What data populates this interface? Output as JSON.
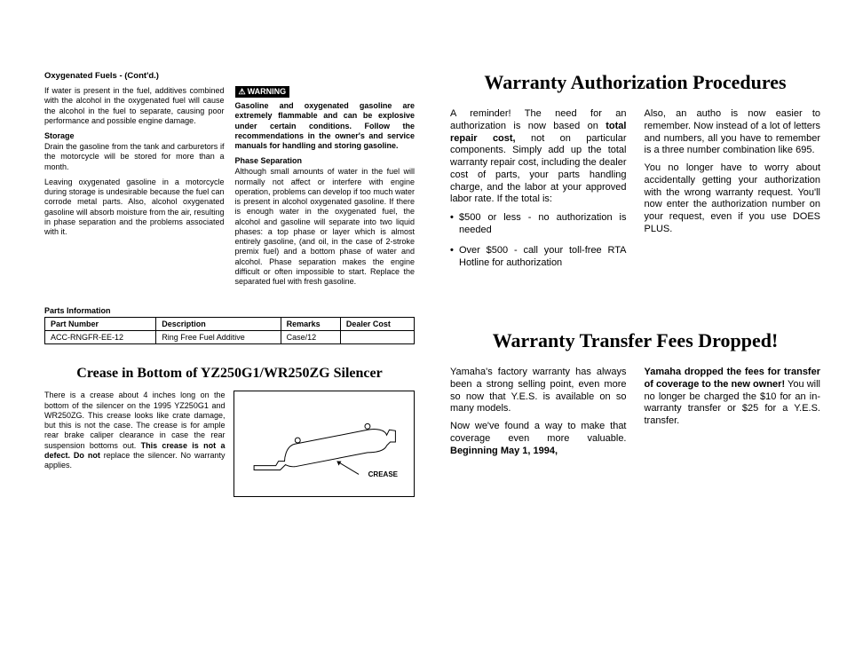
{
  "left": {
    "section_head": "Oxygenated Fuels - (Cont'd.)",
    "col1": {
      "p1": "If water is present in the fuel, additives combined with the alcohol in the oxygenated fuel will cause the alcohol in the fuel to separate, causing poor performance and possible engine damage.",
      "storage_head": "Storage",
      "p2": "Drain the gasoline from the tank and carburetors if the motorcycle will be stored for more than a month.",
      "p3": "Leaving oxygenated gasoline in a motorcycle during storage is undesirable because the fuel can corrode metal parts. Also, alcohol oxygenated gasoline will absorb moisture from the air, resulting in phase separation and the problems associated with it."
    },
    "col2": {
      "warn_label": "WARNING",
      "warn_text": "Gasoline and oxygenated gasoline are extremely flammable and can be explosive under certain conditions. Follow the recommendations in the owner's and service manuals for handling and storing gasoline.",
      "phase_head": "Phase Separation",
      "phase_text": "Although small amounts of water in the fuel will normally not affect or interfere with engine operation, problems can develop if too much water is present in alcohol oxygenated gasoline. If there is enough water in the oxygenated fuel, the alcohol and gasoline will separate into two liquid phases: a top phase or layer which is almost entirely gasoline, (and oil, in the case of 2-stroke premix fuel) and a bottom phase of water and alcohol. Phase separation makes the engine difficult or often impossible to start. Replace the separated fuel with fresh gasoline."
    },
    "parts_head": "Parts Information",
    "table": {
      "h1": "Part Number",
      "h2": "Description",
      "h3": "Remarks",
      "h4": "Dealer Cost",
      "r1c1": "ACC-RNGFR-EE-12",
      "r1c2": "Ring Free Fuel Additive",
      "r1c3": "Case/12",
      "r1c4": ""
    },
    "crease": {
      "title": "Crease in Bottom of YZ250G1/WR250ZG Silencer",
      "text_pre": "There is a crease about 4 inches long on the bottom of the silencer on the 1995 YZ250G1 and WR250ZG. This crease looks like crate damage, but this is not the case. The crease is for ample rear brake caliper clearance in case the rear suspension bottoms out. ",
      "text_bold": "This crease is not a defect. Do not",
      "text_post": " replace the silencer. No warranty applies.",
      "fig_label": "CREASE"
    }
  },
  "right": {
    "auth": {
      "title": "Warranty Authorization Procedures",
      "col1": {
        "p1_pre": "A reminder! The need for an authorization is now based on ",
        "p1_bold": "total repair cost,",
        "p1_post": " not on particular components. Simply add up the total warranty repair cost, including the dealer cost of parts, your parts handling charge, and the labor at your approved labor rate. If the total is:",
        "b1": "$500 or less - no authorization is needed",
        "b2": "Over $500 - call your toll-free RTA Hotline for authorization"
      },
      "col2": {
        "p1": "Also, an autho is now easier to remember. Now instead of a lot of letters and numbers, all you have to remember is a three number combination like 695.",
        "p2": "You no longer have to worry about accidentally getting your authorization with the wrong warranty request. You'll now enter the authorization number on your request, even if you use DOES PLUS."
      }
    },
    "transfer": {
      "title": "Warranty Transfer Fees Dropped!",
      "col1": {
        "p1": "Yamaha's factory warranty has always been a strong selling point, even more so now that Y.E.S. is available on so many models.",
        "p2_pre": "Now we've found a way to make that coverage even more valuable. ",
        "p2_bold": "Beginning May 1, 1994,"
      },
      "col2": {
        "p1_bold": "Yamaha dropped the fees for transfer of coverage to the new owner!",
        "p1_post": " You will no longer be charged the $10 for an in-warranty transfer or $25 for a Y.E.S. transfer."
      }
    }
  }
}
